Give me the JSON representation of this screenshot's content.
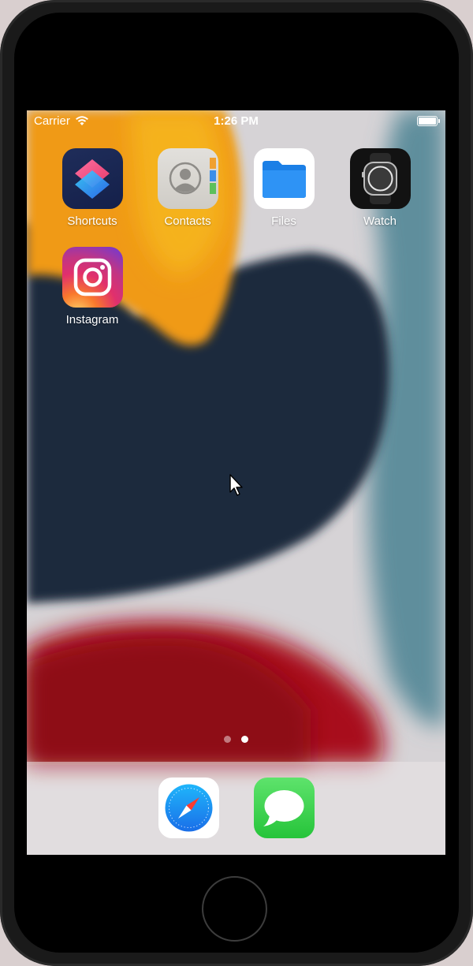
{
  "status_bar": {
    "carrier": "Carrier",
    "time": "1:26 PM",
    "wifi_icon": "wifi-icon",
    "battery_icon": "battery-icon"
  },
  "apps": [
    {
      "label": "Shortcuts",
      "icon": "shortcuts-icon"
    },
    {
      "label": "Contacts",
      "icon": "contacts-icon"
    },
    {
      "label": "Files",
      "icon": "files-icon"
    },
    {
      "label": "Watch",
      "icon": "watch-icon"
    },
    {
      "label": "Instagram",
      "icon": "instagram-icon"
    }
  ],
  "page_indicator": {
    "pages": 2,
    "current": 2
  },
  "dock": [
    {
      "icon": "safari-icon"
    },
    {
      "icon": "messages-icon"
    }
  ],
  "colors": {
    "wallpaper_orange": "#f0a010",
    "wallpaper_navy": "#1c2a3c",
    "wallpaper_red": "#a81018",
    "wallpaper_teal": "#5a8a9a",
    "files_blue": "#1e8cf0",
    "messages_green": "#34c759"
  }
}
